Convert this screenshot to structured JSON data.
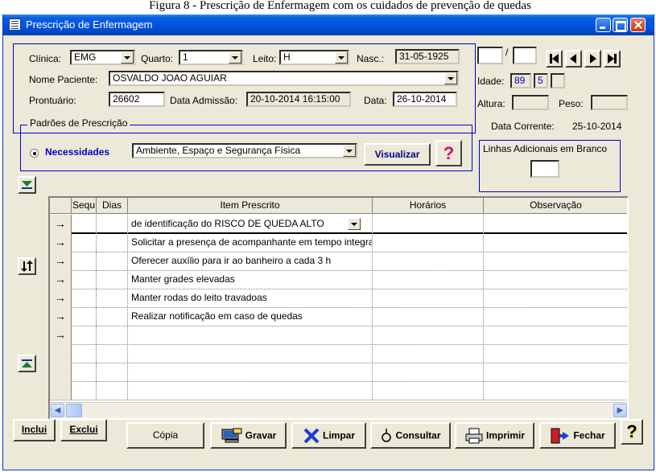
{
  "caption": "Figura 8 - Prescrição de Enfermagem com os cuidados de prevenção de quedas",
  "window": {
    "title": "Prescrição de Enfermagem"
  },
  "form": {
    "clinica_label": "Clínica:",
    "clinica_value": "EMG",
    "quarto_label": "Quarto:",
    "quarto_value": "1",
    "leito_label": "Leito:",
    "leito_value": "H",
    "nasc_label": "Nasc.:",
    "nasc_value": "31-05-1925",
    "nome_label": "Nome Paciente:",
    "nome_value": "OSVALDO JOAO AGUIAR",
    "prontuario_label": "Prontuário:",
    "prontuario_value": "26602",
    "admissao_label": "Data Admissão:",
    "admissao_value": "20-10-2014 16:15:00",
    "data_label": "Data:",
    "data_value": "26-10-2014"
  },
  "padroes": {
    "legend": "Padrões de Prescrição",
    "necessidades_label": "Necessidades",
    "necessidades_value": "Ambiente, Espaço e Segurança Física",
    "visualizar_label": "Visualizar",
    "help_label": "?"
  },
  "right": {
    "date_sep": "/",
    "idade_label": "Idade:",
    "idade_years": "89",
    "idade_months": "5",
    "altura_label": "Altura:",
    "peso_label": "Peso:",
    "data_corrente_label": "Data Corrente:",
    "data_corrente_value": "25-10-2014",
    "linhas_label": "Linhas Adicionais em Branco"
  },
  "grid": {
    "columns": [
      "Sequ",
      "Dias",
      "Item Prescrito",
      "Horários",
      "Observação"
    ],
    "rows": [
      {
        "indicator": "→",
        "item": "de identificação do RISCO DE QUEDA ALTO"
      },
      {
        "indicator": "→",
        "item": "Solicitar a presença de acompanhante em tempo integral"
      },
      {
        "indicator": "→",
        "item": "Oferecer auxílio para ir ao banheiro a cada 3 h"
      },
      {
        "indicator": "→",
        "item": "Manter grades elevadas"
      },
      {
        "indicator": "→",
        "item": "Manter rodas do leito travadoas"
      },
      {
        "indicator": "→",
        "item": "Realizar notificação em caso de quedas"
      },
      {
        "indicator": "→",
        "item": ""
      },
      {
        "indicator": "",
        "item": ""
      },
      {
        "indicator": "",
        "item": ""
      },
      {
        "indicator": "",
        "item": ""
      }
    ]
  },
  "buttons": {
    "inclui": "Inclui",
    "exclui": "Exclui",
    "copia": "Cópia",
    "gravar": "Gravar",
    "limpar": "Limpar",
    "consultar": "Consultar",
    "imprimir": "Imprimir",
    "fechar": "Fechar",
    "help": "?"
  },
  "colors": {
    "titlebar": "#0055e5",
    "accent_blue": "#0000cc",
    "help_magenta": "#e0007a",
    "limpar_x": "#1a3fd6"
  }
}
